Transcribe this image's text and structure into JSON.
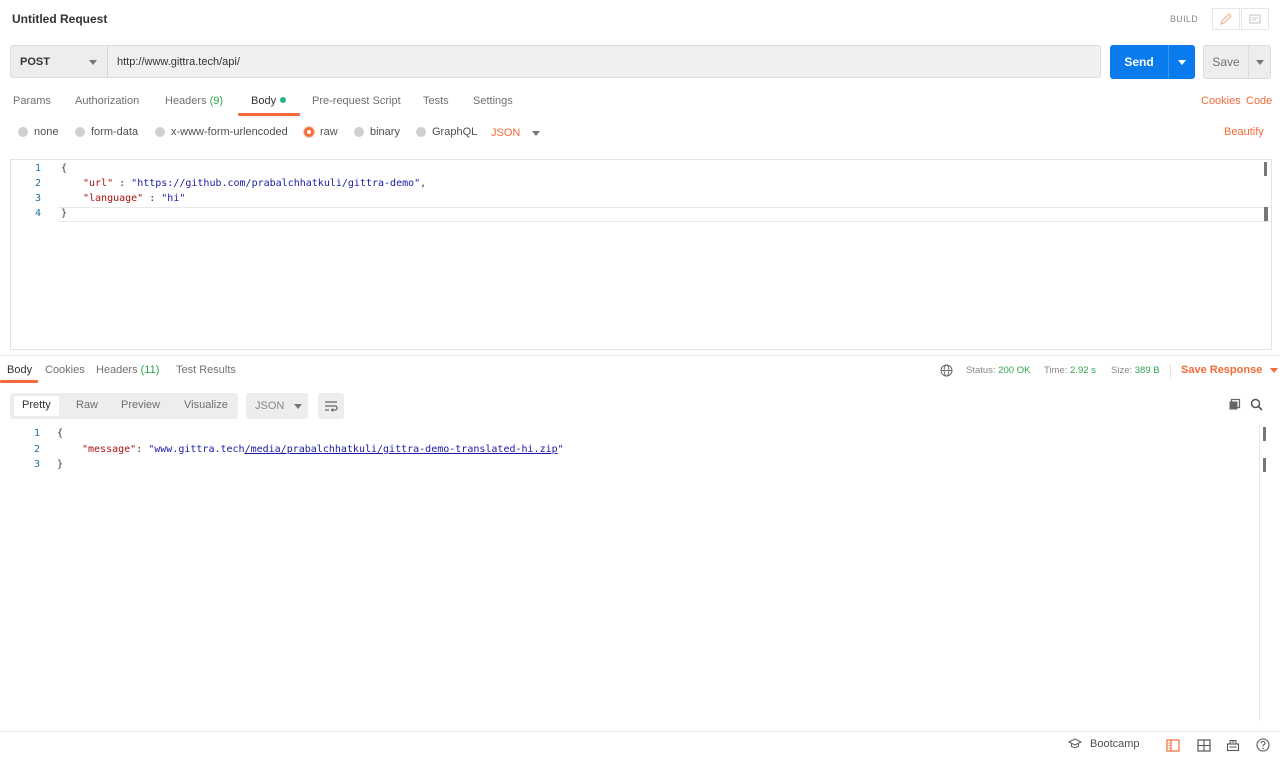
{
  "header": {
    "title": "Untitled Request",
    "mode_label": "BUILD"
  },
  "request": {
    "method": "POST",
    "url": "http://www.gittra.tech/api/",
    "send_label": "Send",
    "save_label": "Save",
    "tabs": [
      {
        "label": "Params"
      },
      {
        "label": "Authorization"
      },
      {
        "label": "Headers",
        "count": "(9)"
      },
      {
        "label": "Body"
      },
      {
        "label": "Pre-request Script"
      },
      {
        "label": "Tests"
      },
      {
        "label": "Settings"
      }
    ],
    "active_tab": "Body",
    "right_links": {
      "cookies": "Cookies",
      "code": "Code"
    },
    "body_types": [
      "none",
      "form-data",
      "x-www-form-urlencoded",
      "raw",
      "binary",
      "GraphQL"
    ],
    "selected_body_type": "raw",
    "format": "JSON",
    "beautify_label": "Beautify",
    "body_lines": [
      {
        "num": "1",
        "text": "{"
      },
      {
        "num": "2",
        "key": "\"url\"",
        "sep": " : ",
        "value": "\"https://github.com/prabalchhatkuli/gittra-demo\"",
        "tail": ","
      },
      {
        "num": "3",
        "key": "\"language\"",
        "sep": " : ",
        "value": "\"hi\"",
        "tail": ""
      },
      {
        "num": "4",
        "text": "}"
      }
    ]
  },
  "response": {
    "tabs": [
      {
        "label": "Body"
      },
      {
        "label": "Cookies"
      },
      {
        "label": "Headers",
        "count": "(11)"
      },
      {
        "label": "Test Results"
      }
    ],
    "active_tab": "Body",
    "status_label": "Status:",
    "status_value": "200 OK",
    "time_label": "Time:",
    "time_value": "2.92 s",
    "size_label": "Size:",
    "size_value": "389 B",
    "save_response_label": "Save Response",
    "view_modes": [
      "Pretty",
      "Raw",
      "Preview",
      "Visualize"
    ],
    "active_view": "Pretty",
    "format": "JSON",
    "body_lines": [
      {
        "num": "1",
        "text": "{"
      },
      {
        "num": "2",
        "key": "\"message\"",
        "sep": ": ",
        "value_plain": "\"www.gittra.tech",
        "value_link": "/media/prabalchhatkuli/gittra-demo-translated-hi.zip",
        "value_end": "\""
      },
      {
        "num": "3",
        "text": "}"
      }
    ]
  },
  "footer": {
    "bootcamp_label": "Bootcamp"
  },
  "colors": {
    "accent": "#f26b3a",
    "send_blue": "#097bed",
    "success_green": "#2ea44f"
  }
}
